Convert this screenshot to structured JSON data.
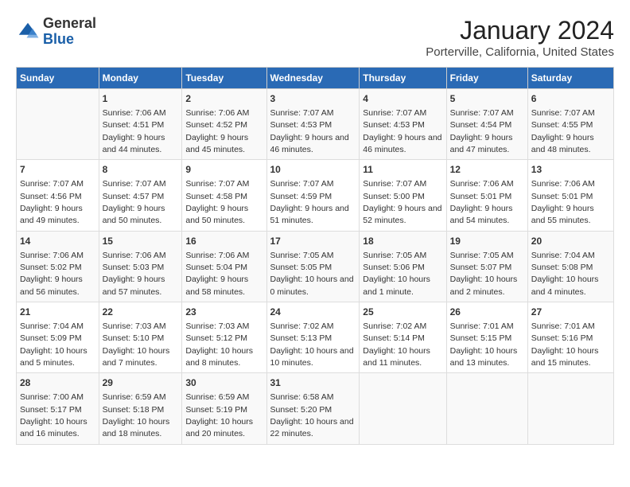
{
  "logo": {
    "general": "General",
    "blue": "Blue"
  },
  "title": "January 2024",
  "subtitle": "Porterville, California, United States",
  "days_header": [
    "Sunday",
    "Monday",
    "Tuesday",
    "Wednesday",
    "Thursday",
    "Friday",
    "Saturday"
  ],
  "weeks": [
    [
      {
        "num": "",
        "sunrise": "",
        "sunset": "",
        "daylight": ""
      },
      {
        "num": "1",
        "sunrise": "Sunrise: 7:06 AM",
        "sunset": "Sunset: 4:51 PM",
        "daylight": "Daylight: 9 hours and 44 minutes."
      },
      {
        "num": "2",
        "sunrise": "Sunrise: 7:06 AM",
        "sunset": "Sunset: 4:52 PM",
        "daylight": "Daylight: 9 hours and 45 minutes."
      },
      {
        "num": "3",
        "sunrise": "Sunrise: 7:07 AM",
        "sunset": "Sunset: 4:53 PM",
        "daylight": "Daylight: 9 hours and 46 minutes."
      },
      {
        "num": "4",
        "sunrise": "Sunrise: 7:07 AM",
        "sunset": "Sunset: 4:53 PM",
        "daylight": "Daylight: 9 hours and 46 minutes."
      },
      {
        "num": "5",
        "sunrise": "Sunrise: 7:07 AM",
        "sunset": "Sunset: 4:54 PM",
        "daylight": "Daylight: 9 hours and 47 minutes."
      },
      {
        "num": "6",
        "sunrise": "Sunrise: 7:07 AM",
        "sunset": "Sunset: 4:55 PM",
        "daylight": "Daylight: 9 hours and 48 minutes."
      }
    ],
    [
      {
        "num": "7",
        "sunrise": "Sunrise: 7:07 AM",
        "sunset": "Sunset: 4:56 PM",
        "daylight": "Daylight: 9 hours and 49 minutes."
      },
      {
        "num": "8",
        "sunrise": "Sunrise: 7:07 AM",
        "sunset": "Sunset: 4:57 PM",
        "daylight": "Daylight: 9 hours and 50 minutes."
      },
      {
        "num": "9",
        "sunrise": "Sunrise: 7:07 AM",
        "sunset": "Sunset: 4:58 PM",
        "daylight": "Daylight: 9 hours and 50 minutes."
      },
      {
        "num": "10",
        "sunrise": "Sunrise: 7:07 AM",
        "sunset": "Sunset: 4:59 PM",
        "daylight": "Daylight: 9 hours and 51 minutes."
      },
      {
        "num": "11",
        "sunrise": "Sunrise: 7:07 AM",
        "sunset": "Sunset: 5:00 PM",
        "daylight": "Daylight: 9 hours and 52 minutes."
      },
      {
        "num": "12",
        "sunrise": "Sunrise: 7:06 AM",
        "sunset": "Sunset: 5:01 PM",
        "daylight": "Daylight: 9 hours and 54 minutes."
      },
      {
        "num": "13",
        "sunrise": "Sunrise: 7:06 AM",
        "sunset": "Sunset: 5:01 PM",
        "daylight": "Daylight: 9 hours and 55 minutes."
      }
    ],
    [
      {
        "num": "14",
        "sunrise": "Sunrise: 7:06 AM",
        "sunset": "Sunset: 5:02 PM",
        "daylight": "Daylight: 9 hours and 56 minutes."
      },
      {
        "num": "15",
        "sunrise": "Sunrise: 7:06 AM",
        "sunset": "Sunset: 5:03 PM",
        "daylight": "Daylight: 9 hours and 57 minutes."
      },
      {
        "num": "16",
        "sunrise": "Sunrise: 7:06 AM",
        "sunset": "Sunset: 5:04 PM",
        "daylight": "Daylight: 9 hours and 58 minutes."
      },
      {
        "num": "17",
        "sunrise": "Sunrise: 7:05 AM",
        "sunset": "Sunset: 5:05 PM",
        "daylight": "Daylight: 10 hours and 0 minutes."
      },
      {
        "num": "18",
        "sunrise": "Sunrise: 7:05 AM",
        "sunset": "Sunset: 5:06 PM",
        "daylight": "Daylight: 10 hours and 1 minute."
      },
      {
        "num": "19",
        "sunrise": "Sunrise: 7:05 AM",
        "sunset": "Sunset: 5:07 PM",
        "daylight": "Daylight: 10 hours and 2 minutes."
      },
      {
        "num": "20",
        "sunrise": "Sunrise: 7:04 AM",
        "sunset": "Sunset: 5:08 PM",
        "daylight": "Daylight: 10 hours and 4 minutes."
      }
    ],
    [
      {
        "num": "21",
        "sunrise": "Sunrise: 7:04 AM",
        "sunset": "Sunset: 5:09 PM",
        "daylight": "Daylight: 10 hours and 5 minutes."
      },
      {
        "num": "22",
        "sunrise": "Sunrise: 7:03 AM",
        "sunset": "Sunset: 5:10 PM",
        "daylight": "Daylight: 10 hours and 7 minutes."
      },
      {
        "num": "23",
        "sunrise": "Sunrise: 7:03 AM",
        "sunset": "Sunset: 5:12 PM",
        "daylight": "Daylight: 10 hours and 8 minutes."
      },
      {
        "num": "24",
        "sunrise": "Sunrise: 7:02 AM",
        "sunset": "Sunset: 5:13 PM",
        "daylight": "Daylight: 10 hours and 10 minutes."
      },
      {
        "num": "25",
        "sunrise": "Sunrise: 7:02 AM",
        "sunset": "Sunset: 5:14 PM",
        "daylight": "Daylight: 10 hours and 11 minutes."
      },
      {
        "num": "26",
        "sunrise": "Sunrise: 7:01 AM",
        "sunset": "Sunset: 5:15 PM",
        "daylight": "Daylight: 10 hours and 13 minutes."
      },
      {
        "num": "27",
        "sunrise": "Sunrise: 7:01 AM",
        "sunset": "Sunset: 5:16 PM",
        "daylight": "Daylight: 10 hours and 15 minutes."
      }
    ],
    [
      {
        "num": "28",
        "sunrise": "Sunrise: 7:00 AM",
        "sunset": "Sunset: 5:17 PM",
        "daylight": "Daylight: 10 hours and 16 minutes."
      },
      {
        "num": "29",
        "sunrise": "Sunrise: 6:59 AM",
        "sunset": "Sunset: 5:18 PM",
        "daylight": "Daylight: 10 hours and 18 minutes."
      },
      {
        "num": "30",
        "sunrise": "Sunrise: 6:59 AM",
        "sunset": "Sunset: 5:19 PM",
        "daylight": "Daylight: 10 hours and 20 minutes."
      },
      {
        "num": "31",
        "sunrise": "Sunrise: 6:58 AM",
        "sunset": "Sunset: 5:20 PM",
        "daylight": "Daylight: 10 hours and 22 minutes."
      },
      {
        "num": "",
        "sunrise": "",
        "sunset": "",
        "daylight": ""
      },
      {
        "num": "",
        "sunrise": "",
        "sunset": "",
        "daylight": ""
      },
      {
        "num": "",
        "sunrise": "",
        "sunset": "",
        "daylight": ""
      }
    ]
  ]
}
